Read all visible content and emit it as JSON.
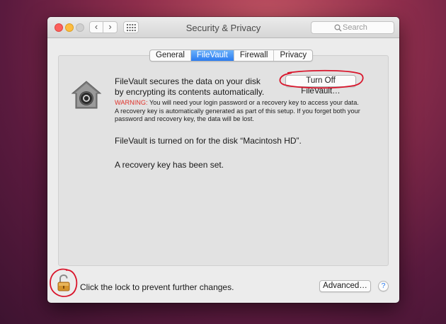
{
  "window": {
    "title": "Security & Privacy",
    "search_placeholder": "Search"
  },
  "nav": {
    "back_glyph": "‹",
    "forward_glyph": "›"
  },
  "tabs": [
    {
      "label": "General",
      "active": false
    },
    {
      "label": "FileVault",
      "active": true
    },
    {
      "label": "Firewall",
      "active": false
    },
    {
      "label": "Privacy",
      "active": false
    }
  ],
  "filevault": {
    "description": "FileVault secures the data on your disk by encrypting its contents automatically.",
    "turn_off_label": "Turn Off FileVault…",
    "warning_label": "WARNING:",
    "warning_text": " You will need your login password or a recovery key to access your data. A recovery key is automatically generated as part of this setup. If you forget both your password and recovery key, the data will be lost.",
    "status_disk": "FileVault is turned on for the disk “Macintosh HD”.",
    "status_recovery": "A recovery key has been set."
  },
  "footer": {
    "lock_text": "Click the lock to prevent further changes.",
    "advanced_label": "Advanced…",
    "help_label": "?"
  },
  "colors": {
    "accent": "#2b7cf0",
    "warning": "#e0332b",
    "annotation": "#d9152b"
  },
  "icons": [
    "back-icon",
    "forward-icon",
    "grid-icon",
    "search-icon",
    "filevault-icon",
    "lock-icon"
  ]
}
